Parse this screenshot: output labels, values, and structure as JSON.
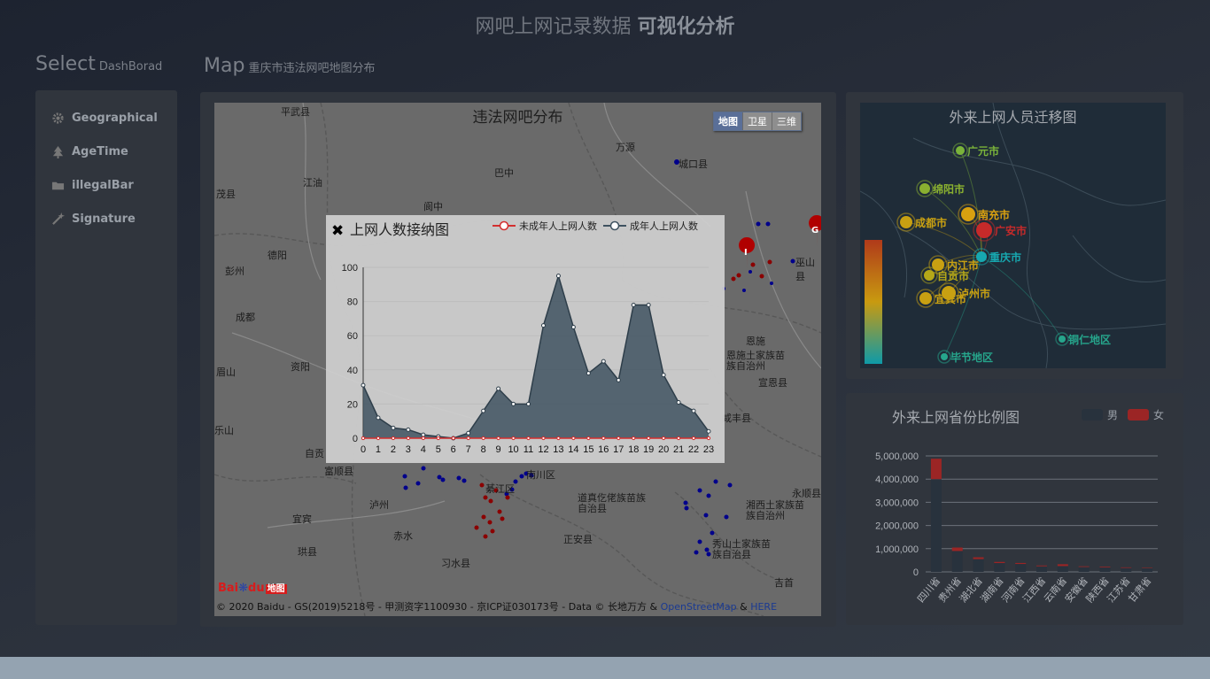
{
  "header": {
    "title_light": "网吧上网记录数据 ",
    "title_bold": "可视化分析"
  },
  "select_section": {
    "title": "Select",
    "subtitle": "DashBorad"
  },
  "map_section": {
    "title": "Map",
    "subtitle": "重庆市违法网吧地图分布"
  },
  "sidebar": {
    "items": [
      {
        "label": "Geographical",
        "icon": "gear-icon"
      },
      {
        "label": "AgeTime",
        "icon": "tree-icon"
      },
      {
        "label": "illegalBar",
        "icon": "folder-icon"
      },
      {
        "label": "Signature",
        "icon": "magic-wand-icon"
      }
    ]
  },
  "map": {
    "title": "违法网吧分布",
    "types": [
      "地图",
      "卫星",
      "三维"
    ],
    "active_type": "地图",
    "copyright_text": "© 2020 Baidu - GS(2019)5218号 - 甲测资字1100930 - 京ICP证030173号 - Data © 长地万方 & ",
    "copyright_link1": "OpenStreetMap",
    "copyright_amp": " & ",
    "copyright_link2": "HERE",
    "logo_text_bai": "Bai",
    "logo_text_du": "du",
    "logo_text_map": "地图",
    "place_labels": [
      "平武县",
      "万源",
      "城口县",
      "巴中",
      "茂县",
      "江油",
      "阆中",
      "绵竹",
      "德阳",
      "彭州",
      "南江",
      "巫山县",
      "成都",
      "眉山",
      "资阳",
      "恩施",
      "恩施土家族苗族自治州",
      "宣恩县",
      "咸丰县",
      "自贡",
      "富顺县",
      "泸州",
      "綦江区",
      "南川区",
      "道真仡佬族苗族自治县",
      "永顺县",
      "湘西土家族苗族自治州",
      "宜宾",
      "珙县",
      "赤水",
      "习水县",
      "正安县",
      "秀山土家族苗族自治县",
      "吉首",
      "乐山"
    ],
    "marker_letters": [
      "G",
      "D",
      "E",
      "I",
      "H",
      "J"
    ]
  },
  "popup": {
    "title": "上网人数接纳图",
    "close_icon": "close-icon"
  },
  "colors": {
    "adult_series": "#3f5260",
    "minor_series": "#d32f2f",
    "male_bar": "#28323d",
    "female_bar": "#9b2525",
    "panel_bg": "#30353d"
  },
  "chart_data": [
    {
      "type": "area",
      "title": "上网人数接纳图",
      "x": [
        0,
        1,
        2,
        3,
        4,
        5,
        6,
        7,
        8,
        9,
        10,
        11,
        12,
        13,
        14,
        15,
        16,
        17,
        18,
        19,
        20,
        21,
        22,
        23
      ],
      "series": [
        {
          "name": "未成年人上网人数",
          "values": [
            0,
            0,
            0,
            0,
            0,
            0,
            0,
            0,
            0,
            0,
            0,
            0,
            0,
            0,
            0,
            0,
            0,
            0,
            0,
            0,
            0,
            0,
            0,
            0
          ]
        },
        {
          "name": "成年人上网人数",
          "values": [
            31,
            12,
            6,
            5,
            2,
            1,
            0,
            3,
            16,
            29,
            20,
            20,
            66,
            95,
            65,
            38,
            45,
            34,
            78,
            78,
            37,
            21,
            16,
            4
          ]
        }
      ],
      "ylim": [
        0,
        100
      ],
      "yticks": [
        0,
        20,
        40,
        60,
        80,
        100
      ],
      "legend": "top-right"
    },
    {
      "type": "bar",
      "title": "外来上网省份比例图",
      "categories": [
        "四川省",
        "贵州省",
        "湖北省",
        "湖南省",
        "河南省",
        "江西省",
        "云南省",
        "安徽省",
        "陕西省",
        "江苏省",
        "甘肃省"
      ],
      "series": [
        {
          "name": "男",
          "values": [
            4000000,
            900000,
            550000,
            380000,
            340000,
            240000,
            250000,
            210000,
            190000,
            170000,
            160000
          ]
        },
        {
          "name": "女",
          "values": [
            880000,
            150000,
            80000,
            50000,
            45000,
            35000,
            80000,
            30000,
            30000,
            25000,
            20000
          ]
        }
      ],
      "stacked": true,
      "ylim": [
        0,
        5000000
      ],
      "yticks": [
        "0",
        "1,000,000",
        "2,000,000",
        "3,000,000",
        "4,000,000",
        "5,000,000"
      ],
      "legend": "top-right"
    },
    {
      "type": "scatter",
      "title": "外来上网人员迁移图",
      "points": [
        {
          "name": "广元市",
          "color": "#7ab33a"
        },
        {
          "name": "绵阳市",
          "color": "#8ab030"
        },
        {
          "name": "成都市",
          "color": "#c8a012"
        },
        {
          "name": "南充市",
          "color": "#d8a010"
        },
        {
          "name": "广安市",
          "color": "#c62a2a"
        },
        {
          "name": "重庆市",
          "color": "#17a8b0"
        },
        {
          "name": "内江市",
          "color": "#c8a012"
        },
        {
          "name": "自贡市",
          "color": "#b5a818"
        },
        {
          "name": "泸州市",
          "color": "#c8a012"
        },
        {
          "name": "宜宾市",
          "color": "#c8a012"
        },
        {
          "name": "铜仁地区",
          "color": "#26a68c"
        },
        {
          "name": "毕节地区",
          "color": "#26a68c"
        }
      ],
      "legend": "left"
    }
  ],
  "right_bottom": {
    "title": "外来上网省份比例图",
    "legend_male": "男",
    "legend_female": "女"
  },
  "right_top": {
    "title": "外来上网人员迁移图"
  }
}
